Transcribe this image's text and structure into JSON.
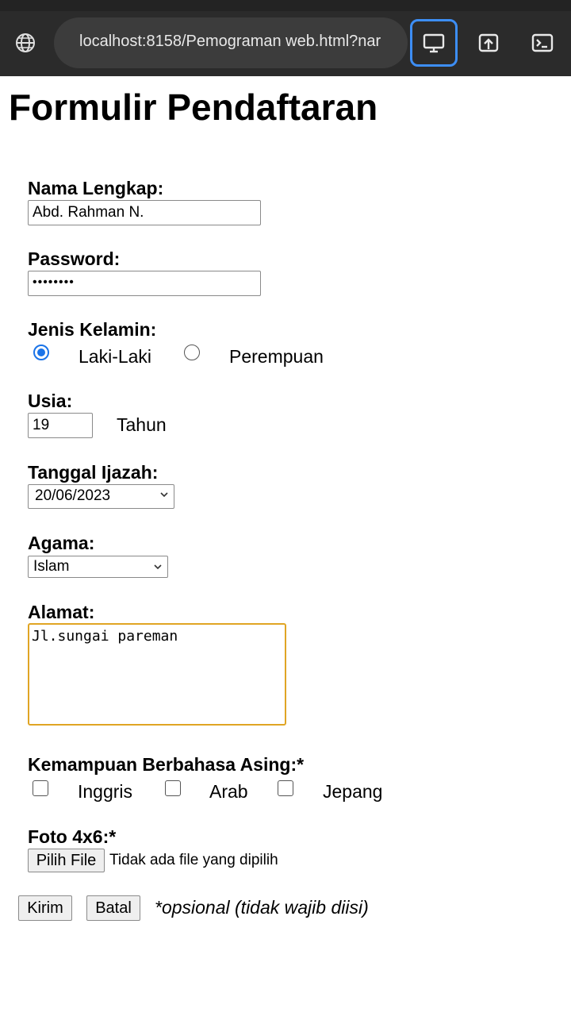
{
  "browser": {
    "url": "localhost:8158/Pemograman web.html?nar",
    "icons": [
      "globe-icon",
      "desktop-icon",
      "share-icon",
      "terminal-icon"
    ]
  },
  "page": {
    "title": "Formulir Pendaftaran"
  },
  "form": {
    "nama_label": "Nama Lengkap:",
    "nama_value": "Abd. Rahman N.",
    "password_label": "Password:",
    "password_value": "••••••••",
    "gender_label": "Jenis Kelamin:",
    "gender_options": [
      "Laki-Laki",
      "Perempuan"
    ],
    "gender_selected": "Laki-Laki",
    "usia_label": "Usia:",
    "usia_value": "19",
    "usia_unit": "Tahun",
    "tanggal_label": "Tanggal Ijazah:",
    "tanggal_value": "20/06/2023",
    "agama_label": "Agama:",
    "agama_value": "Islam",
    "alamat_label": "Alamat:",
    "alamat_value": "Jl.sungai pareman",
    "bahasa_label": "Kemampuan Berbahasa Asing:*",
    "bahasa_options": [
      "Inggris",
      "Arab",
      "Jepang"
    ],
    "foto_label": "Foto 4x6:*",
    "file_button": "Pilih File",
    "file_status": "Tidak ada file yang dipilih",
    "submit_label": "Kirim",
    "cancel_label": "Batal",
    "note": "*opsional (tidak wajib diisi)"
  },
  "colors": {
    "accent": "#1a73e8",
    "focus_border": "#e0a524",
    "toolbar_bg": "#2b2b2b",
    "active_outline": "#3d8ef5"
  }
}
